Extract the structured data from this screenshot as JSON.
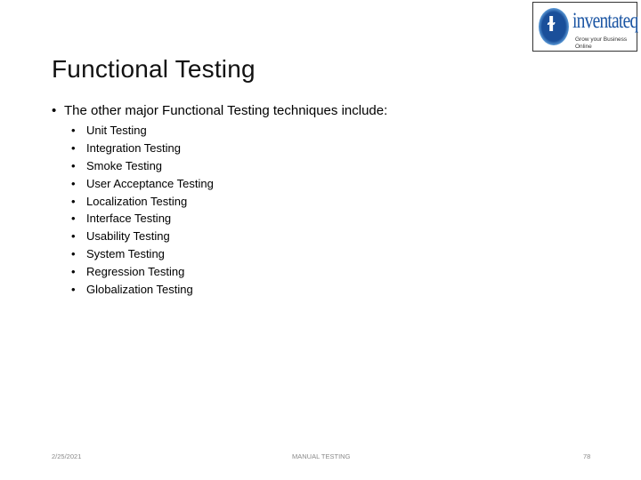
{
  "logo": {
    "icon": "inventateq-logo-icon",
    "glyph": "⫛",
    "wordmark": "inventateq",
    "tagline": "Grow your Business Online"
  },
  "slide": {
    "title": "Functional Testing",
    "intro": "The other major Functional Testing techniques include:",
    "bullet_glyph": "•",
    "items": [
      "Unit Testing",
      "Integration Testing",
      "Smoke Testing",
      "User Acceptance Testing",
      "Localization Testing",
      "Interface Testing",
      "Usability Testing",
      "System Testing",
      "Regression Testing",
      "Globalization Testing"
    ]
  },
  "footer": {
    "date": "2/25/2021",
    "center": "MANUAL TESTING",
    "page": "78"
  }
}
